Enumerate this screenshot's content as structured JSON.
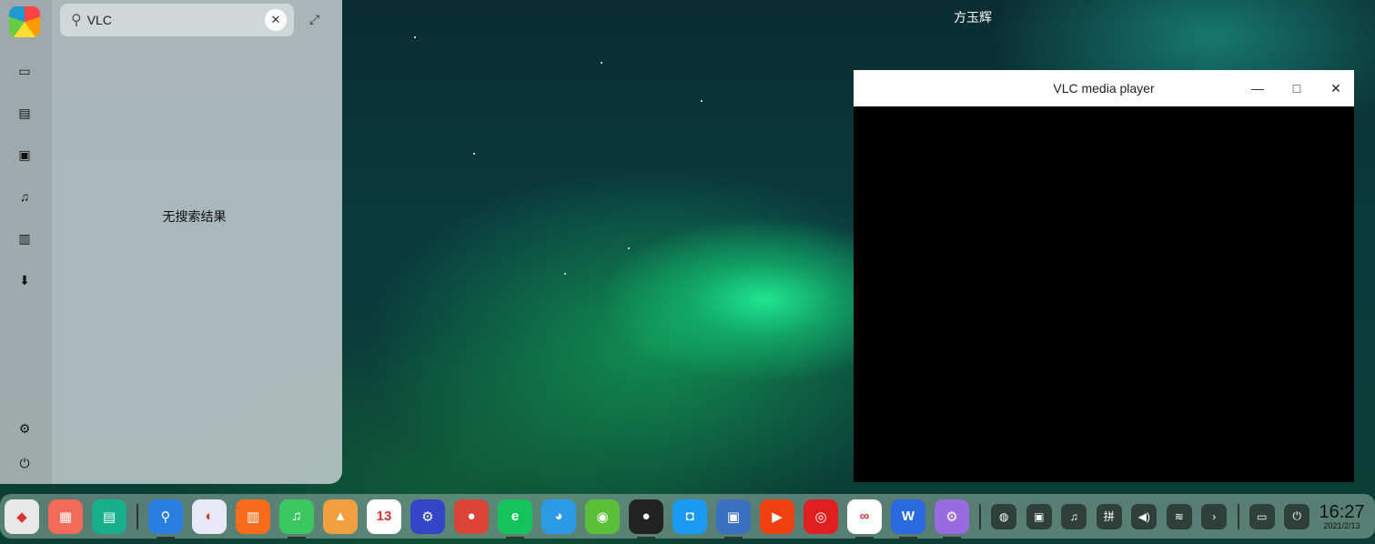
{
  "desktop": {
    "user_name": "方玉辉"
  },
  "launcher": {
    "search": {
      "value": "VLC",
      "placeholder": ""
    },
    "no_result": "无搜索结果",
    "sidebar": [
      "computer",
      "documents",
      "pictures",
      "music",
      "videos",
      "downloads",
      "settings",
      "power"
    ]
  },
  "vlc_window": {
    "title": "VLC media player"
  },
  "dock": {
    "apps": [
      {
        "name": "launcher",
        "color": "#e8e8e8",
        "glyph": "◆",
        "running": false
      },
      {
        "name": "multitasking-view",
        "color": "#f46a5a",
        "glyph": "▦",
        "running": false
      },
      {
        "name": "show-desktop",
        "color": "#18b08c",
        "glyph": "▤",
        "running": false
      },
      {
        "sep": true
      },
      {
        "name": "file-manager",
        "color": "#2a7de1",
        "glyph": "⚲",
        "running": true
      },
      {
        "name": "browser",
        "color": "#e8e8f8",
        "glyph": "◐",
        "running": false
      },
      {
        "name": "app-store",
        "color": "#f76b1c",
        "glyph": "▥",
        "running": false
      },
      {
        "name": "music",
        "color": "#3cc860",
        "glyph": "♫",
        "running": true
      },
      {
        "name": "image-viewer",
        "color": "#f0a040",
        "glyph": "▲",
        "running": false
      },
      {
        "name": "calendar",
        "color": "#ffffff",
        "glyph": "13",
        "running": false
      },
      {
        "name": "control-center",
        "color": "#3445c8",
        "glyph": "⚙",
        "running": false
      },
      {
        "name": "chrome",
        "color": "#db4437",
        "glyph": "●",
        "running": false
      },
      {
        "name": "browser-e",
        "color": "#14c45a",
        "glyph": "e",
        "running": true
      },
      {
        "name": "chat-bubble",
        "color": "#2b9be8",
        "glyph": "◕",
        "running": false
      },
      {
        "name": "wechat",
        "color": "#5ac03a",
        "glyph": "◉",
        "running": false
      },
      {
        "name": "qq",
        "color": "#222222",
        "glyph": "●",
        "running": true
      },
      {
        "name": "dingtalk",
        "color": "#1a9af0",
        "glyph": "◘",
        "running": false
      },
      {
        "name": "virtualbox",
        "color": "#3a70c0",
        "glyph": "▣",
        "running": true
      },
      {
        "name": "xmind",
        "color": "#f04010",
        "glyph": "▶",
        "running": false
      },
      {
        "name": "netease-music",
        "color": "#e02020",
        "glyph": "◎",
        "running": false
      },
      {
        "name": "baidu-netdisk",
        "color": "#ffffff",
        "glyph": "∞",
        "running": true
      },
      {
        "name": "wps",
        "color": "#2a6ae0",
        "glyph": "W",
        "running": true
      },
      {
        "name": "settings-app",
        "color": "#9a6ae0",
        "glyph": "⚙",
        "running": true
      }
    ],
    "tray": [
      "screen-recorder",
      "window-switch",
      "music-tray",
      "pinyin",
      "volume",
      "wifi",
      "expand"
    ],
    "tray_glyphs": [
      "◍",
      "▣",
      "♫",
      "拼",
      "◀)",
      "≋",
      "›"
    ],
    "system": [
      "keyboard",
      "power"
    ],
    "system_glyphs": [
      "▭",
      "⏻"
    ],
    "clock": {
      "time": "16:27",
      "date": "2021/2/13"
    }
  }
}
